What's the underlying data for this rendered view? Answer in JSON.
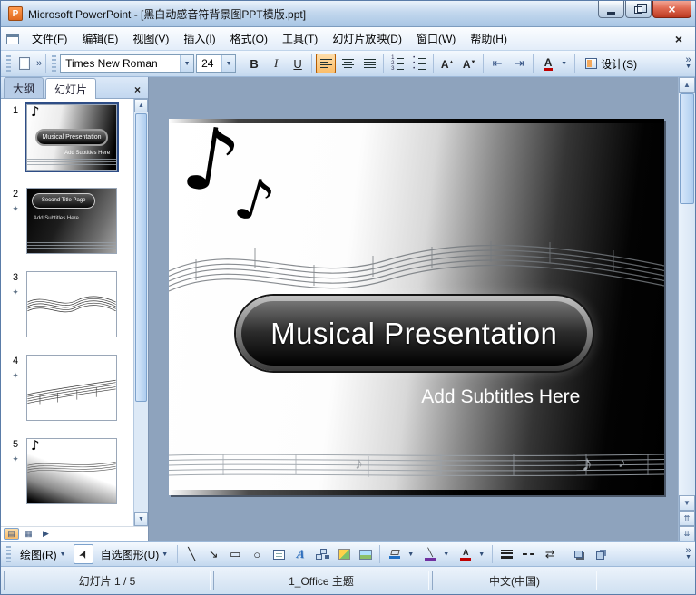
{
  "window": {
    "title": "Microsoft PowerPoint - [黑白动感音符背景图PPT模版.ppt]",
    "app_initial": "P"
  },
  "menu": {
    "items": [
      "文件(F)",
      "编辑(E)",
      "视图(V)",
      "插入(I)",
      "格式(O)",
      "工具(T)",
      "幻灯片放映(D)",
      "窗口(W)",
      "帮助(H)"
    ]
  },
  "toolbar": {
    "font_name": "Times New Roman",
    "font_size": "24",
    "bold": "B",
    "italic": "I",
    "underline": "U",
    "increase_font": "A",
    "decrease_font": "A",
    "font_color_letter": "A",
    "design": "设计(S)"
  },
  "left_pane": {
    "tabs": [
      "大纲",
      "幻灯片"
    ],
    "active_tab": "幻灯片"
  },
  "thumbnails": [
    {
      "number": "1",
      "title": "Musical Presentation",
      "subtitle": "Add Subtitles Here"
    },
    {
      "number": "2",
      "title": "Second Title Page",
      "subtitle": "Add Subtitles Here"
    },
    {
      "number": "3"
    },
    {
      "number": "4"
    },
    {
      "number": "5"
    }
  ],
  "slide": {
    "title": "Musical Presentation",
    "subtitle": "Add Subtitles Here"
  },
  "drawing": {
    "draw": "绘图(R)",
    "autoshapes": "自选图形(U)",
    "wordart_letter": "A",
    "font_color_letter": "A"
  },
  "status": {
    "slide": "幻灯片 1 / 5",
    "theme": "1_Office 主题",
    "language": "中文(中国)"
  },
  "icons": {
    "music_note": "♪",
    "dropdown": "▼",
    "up": "▲",
    "down": "▼",
    "double_up": "⇈",
    "double_down": "⇊",
    "close_x": "×",
    "chevron": "»",
    "star": "✦",
    "cursor": "➤",
    "line": "╲",
    "arrow": "↘",
    "rectangle": "▭",
    "oval": "○",
    "indent_dec": "⇤",
    "indent_inc": "⇥",
    "arrow_style": "⇄",
    "normal_view": "▤",
    "sorter_view": "▦",
    "show_view": "▶"
  },
  "colors": {
    "selected_highlight": "#fbbd69",
    "close_button_red": "#bb3a22",
    "font_color_indicator": "#c00000",
    "fill_color_indicator": "#1f6fc4",
    "line_color_indicator": "#7030a0"
  }
}
